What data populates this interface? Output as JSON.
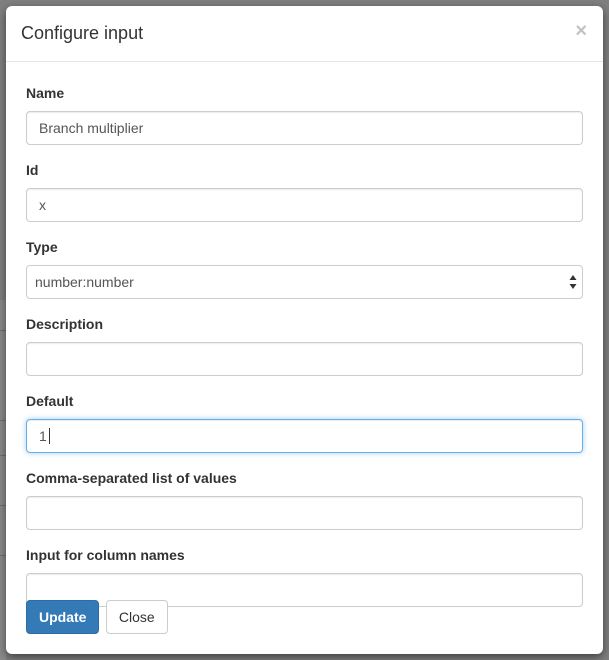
{
  "dialog": {
    "title": "Configure input",
    "close_glyph": "×"
  },
  "fields": {
    "name": {
      "label": "Name",
      "value": "Branch multiplier"
    },
    "id": {
      "label": "Id",
      "value": "x"
    },
    "type": {
      "label": "Type",
      "selected": "number:number"
    },
    "description": {
      "label": "Description",
      "value": ""
    },
    "default": {
      "label": "Default",
      "value": "1"
    },
    "values_list": {
      "label": "Comma-separated list of values",
      "value": ""
    },
    "column_names": {
      "label": "Input for column names",
      "value": ""
    }
  },
  "buttons": {
    "update": "Update",
    "close": "Close"
  },
  "colors": {
    "primary": "#337ab7",
    "focus_border": "#66afe9"
  },
  "icons": {
    "close": "close-icon",
    "select_arrows": "up-down-arrows-icon"
  }
}
